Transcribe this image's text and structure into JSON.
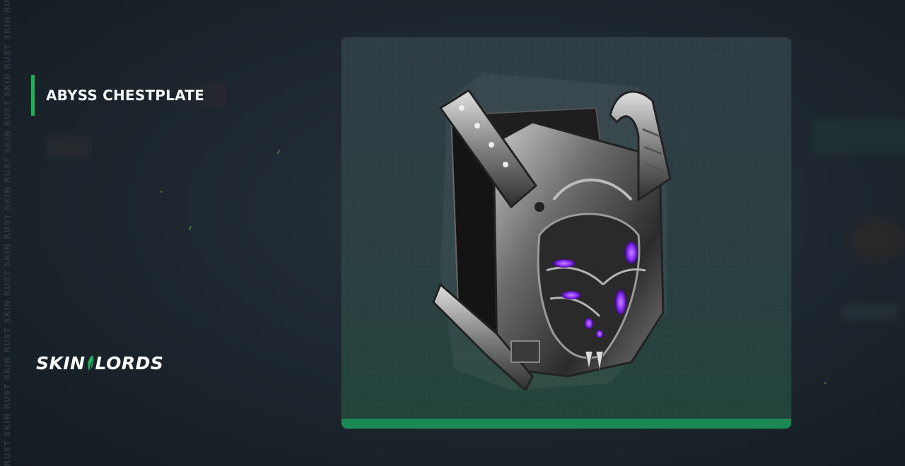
{
  "item": {
    "name": "ABYSS CHESTPLATE"
  },
  "brand": {
    "left": "SKIN",
    "right": "LORDS"
  },
  "watermark": "RUST SKIN RUST SKIN RUST SKIN RUST SKIN RUST SKIN RUST SKIN RUST SKIN RUST SKIN RUST SKIN",
  "colors": {
    "accent": "#1fae5b",
    "card_bar": "#1a8a55",
    "armor_glow": "#8a2cff"
  },
  "icons": {
    "item_image": "chestplate-armor-icon",
    "logo_mark": "leaf-icon"
  }
}
